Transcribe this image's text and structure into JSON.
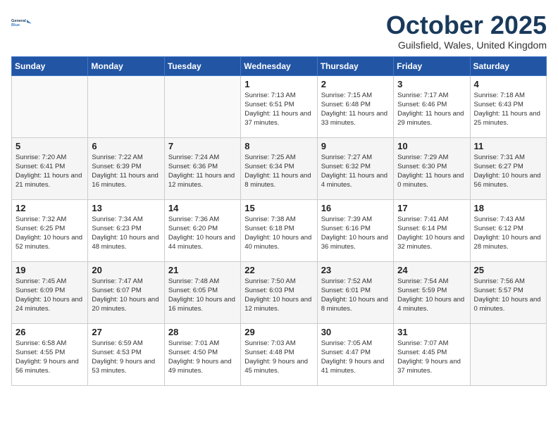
{
  "logo": {
    "line1": "General",
    "line2": "Blue"
  },
  "title": "October 2025",
  "subtitle": "Guilsfield, Wales, United Kingdom",
  "days_of_week": [
    "Sunday",
    "Monday",
    "Tuesday",
    "Wednesday",
    "Thursday",
    "Friday",
    "Saturday"
  ],
  "weeks": [
    [
      {
        "day": "",
        "detail": ""
      },
      {
        "day": "",
        "detail": ""
      },
      {
        "day": "",
        "detail": ""
      },
      {
        "day": "1",
        "detail": "Sunrise: 7:13 AM\nSunset: 6:51 PM\nDaylight: 11 hours\nand 37 minutes."
      },
      {
        "day": "2",
        "detail": "Sunrise: 7:15 AM\nSunset: 6:48 PM\nDaylight: 11 hours\nand 33 minutes."
      },
      {
        "day": "3",
        "detail": "Sunrise: 7:17 AM\nSunset: 6:46 PM\nDaylight: 11 hours\nand 29 minutes."
      },
      {
        "day": "4",
        "detail": "Sunrise: 7:18 AM\nSunset: 6:43 PM\nDaylight: 11 hours\nand 25 minutes."
      }
    ],
    [
      {
        "day": "5",
        "detail": "Sunrise: 7:20 AM\nSunset: 6:41 PM\nDaylight: 11 hours\nand 21 minutes."
      },
      {
        "day": "6",
        "detail": "Sunrise: 7:22 AM\nSunset: 6:39 PM\nDaylight: 11 hours\nand 16 minutes."
      },
      {
        "day": "7",
        "detail": "Sunrise: 7:24 AM\nSunset: 6:36 PM\nDaylight: 11 hours\nand 12 minutes."
      },
      {
        "day": "8",
        "detail": "Sunrise: 7:25 AM\nSunset: 6:34 PM\nDaylight: 11 hours\nand 8 minutes."
      },
      {
        "day": "9",
        "detail": "Sunrise: 7:27 AM\nSunset: 6:32 PM\nDaylight: 11 hours\nand 4 minutes."
      },
      {
        "day": "10",
        "detail": "Sunrise: 7:29 AM\nSunset: 6:30 PM\nDaylight: 11 hours\nand 0 minutes."
      },
      {
        "day": "11",
        "detail": "Sunrise: 7:31 AM\nSunset: 6:27 PM\nDaylight: 10 hours\nand 56 minutes."
      }
    ],
    [
      {
        "day": "12",
        "detail": "Sunrise: 7:32 AM\nSunset: 6:25 PM\nDaylight: 10 hours\nand 52 minutes."
      },
      {
        "day": "13",
        "detail": "Sunrise: 7:34 AM\nSunset: 6:23 PM\nDaylight: 10 hours\nand 48 minutes."
      },
      {
        "day": "14",
        "detail": "Sunrise: 7:36 AM\nSunset: 6:20 PM\nDaylight: 10 hours\nand 44 minutes."
      },
      {
        "day": "15",
        "detail": "Sunrise: 7:38 AM\nSunset: 6:18 PM\nDaylight: 10 hours\nand 40 minutes."
      },
      {
        "day": "16",
        "detail": "Sunrise: 7:39 AM\nSunset: 6:16 PM\nDaylight: 10 hours\nand 36 minutes."
      },
      {
        "day": "17",
        "detail": "Sunrise: 7:41 AM\nSunset: 6:14 PM\nDaylight: 10 hours\nand 32 minutes."
      },
      {
        "day": "18",
        "detail": "Sunrise: 7:43 AM\nSunset: 6:12 PM\nDaylight: 10 hours\nand 28 minutes."
      }
    ],
    [
      {
        "day": "19",
        "detail": "Sunrise: 7:45 AM\nSunset: 6:09 PM\nDaylight: 10 hours\nand 24 minutes."
      },
      {
        "day": "20",
        "detail": "Sunrise: 7:47 AM\nSunset: 6:07 PM\nDaylight: 10 hours\nand 20 minutes."
      },
      {
        "day": "21",
        "detail": "Sunrise: 7:48 AM\nSunset: 6:05 PM\nDaylight: 10 hours\nand 16 minutes."
      },
      {
        "day": "22",
        "detail": "Sunrise: 7:50 AM\nSunset: 6:03 PM\nDaylight: 10 hours\nand 12 minutes."
      },
      {
        "day": "23",
        "detail": "Sunrise: 7:52 AM\nSunset: 6:01 PM\nDaylight: 10 hours\nand 8 minutes."
      },
      {
        "day": "24",
        "detail": "Sunrise: 7:54 AM\nSunset: 5:59 PM\nDaylight: 10 hours\nand 4 minutes."
      },
      {
        "day": "25",
        "detail": "Sunrise: 7:56 AM\nSunset: 5:57 PM\nDaylight: 10 hours\nand 0 minutes."
      }
    ],
    [
      {
        "day": "26",
        "detail": "Sunrise: 6:58 AM\nSunset: 4:55 PM\nDaylight: 9 hours\nand 56 minutes."
      },
      {
        "day": "27",
        "detail": "Sunrise: 6:59 AM\nSunset: 4:53 PM\nDaylight: 9 hours\nand 53 minutes."
      },
      {
        "day": "28",
        "detail": "Sunrise: 7:01 AM\nSunset: 4:50 PM\nDaylight: 9 hours\nand 49 minutes."
      },
      {
        "day": "29",
        "detail": "Sunrise: 7:03 AM\nSunset: 4:48 PM\nDaylight: 9 hours\nand 45 minutes."
      },
      {
        "day": "30",
        "detail": "Sunrise: 7:05 AM\nSunset: 4:47 PM\nDaylight: 9 hours\nand 41 minutes."
      },
      {
        "day": "31",
        "detail": "Sunrise: 7:07 AM\nSunset: 4:45 PM\nDaylight: 9 hours\nand 37 minutes."
      },
      {
        "day": "",
        "detail": ""
      }
    ]
  ]
}
